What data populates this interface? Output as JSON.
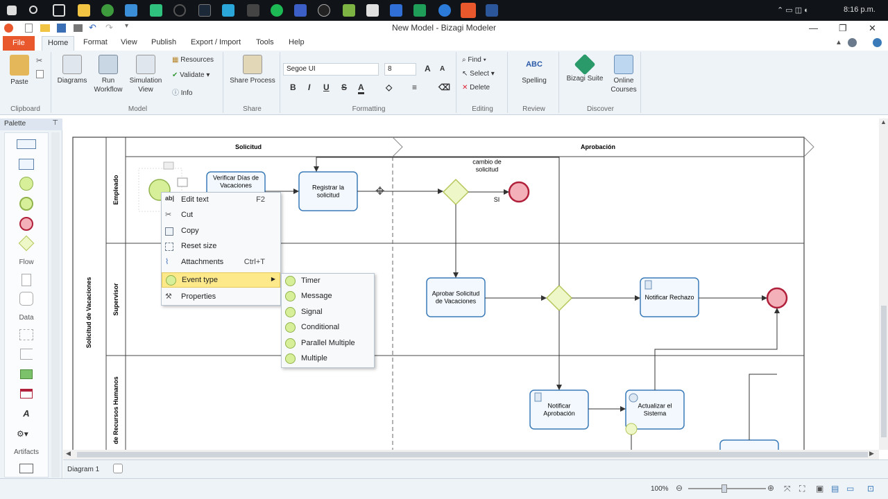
{
  "taskbar": {
    "clock": "8:16 p.m."
  },
  "window": {
    "title": "New Model - Bizagi Modeler"
  },
  "menu_tabs": [
    "File",
    "Home",
    "Format",
    "View",
    "Publish",
    "Export / Import",
    "Tools",
    "Help"
  ],
  "ribbon": {
    "clipboard": {
      "label": "Clipboard",
      "paste": "Paste"
    },
    "model": {
      "label": "Model",
      "diagrams": "Diagrams",
      "run_workflow": "Run Workflow",
      "simulation_view": "Simulation View",
      "resources": "Resources",
      "validate": "Validate",
      "info": "Info"
    },
    "share": {
      "label": "Share",
      "share_process": "Share Process"
    },
    "formatting": {
      "label": "Formatting",
      "font": "Segoe UI",
      "size": "8",
      "bold": "B",
      "italic": "I",
      "underline": "U",
      "strike": "S"
    },
    "editing": {
      "label": "Editing",
      "find": "Find",
      "select": "Select",
      "delete": "Delete"
    },
    "review": {
      "label": "Review",
      "spelling": "Spelling"
    },
    "discover": {
      "label": "Discover",
      "bizagi_suite": "Bizagi Suite",
      "online_courses": "Online Courses"
    }
  },
  "palette": {
    "title": "Palette",
    "flow": "Flow",
    "data": "Data",
    "artifacts": "Artifacts"
  },
  "diagram": {
    "pool": "Solicitud de Vacaciones",
    "phases": [
      "Solicitud",
      "Aprobación"
    ],
    "lanes": [
      "Empleado",
      "Supervisor",
      "de Recursos Humanos"
    ],
    "tasks": {
      "verificar": "Verificar Días de Vacaciones",
      "registrar": "Registrar la solicitud",
      "aprobar": "Aprobar Solicitud de Vacaciones",
      "rechazo": "Notificar Rechazo",
      "aprobacion": "Notificar Aprobación",
      "actualizar": "Actualizar el Sistema"
    },
    "gateway_label": "cambio de solicitud",
    "flow_label_si": "SI"
  },
  "context_menu": {
    "items": [
      {
        "label": "Edit text",
        "shortcut": "F2"
      },
      {
        "label": "Cut",
        "shortcut": ""
      },
      {
        "label": "Copy",
        "shortcut": ""
      },
      {
        "label": "Reset size",
        "shortcut": ""
      },
      {
        "label": "Attachments",
        "shortcut": "Ctrl+T"
      },
      {
        "label": "Event type",
        "shortcut": ""
      },
      {
        "label": "Properties",
        "shortcut": ""
      }
    ],
    "submenu": [
      "Timer",
      "Message",
      "Signal",
      "Conditional",
      "Parallel Multiple",
      "Multiple"
    ]
  },
  "diagram_tab": "Diagram 1",
  "status": {
    "zoom": "100%"
  },
  "colors": {
    "file_tab": "#e8582c",
    "accent_blue": "#3a7ab8",
    "highlight": "#fde98a"
  }
}
